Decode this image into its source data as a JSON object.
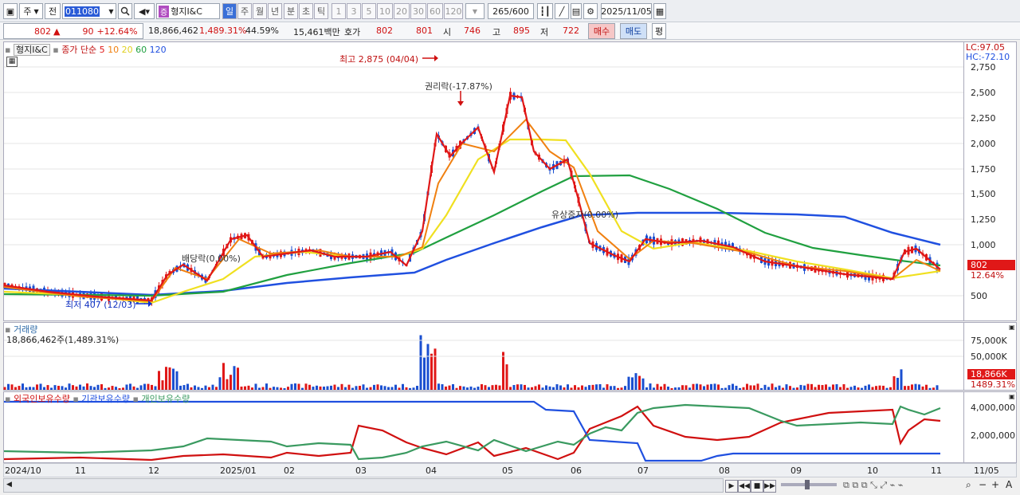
{
  "toolbar": {
    "period_select": "주",
    "prev_label": "전",
    "code_input": "011080",
    "badge": "증",
    "stock_name": "형지I&C",
    "periods": [
      "일",
      "주",
      "월",
      "년",
      "분",
      "초",
      "틱"
    ],
    "active_period": "일",
    "intervals": [
      "1",
      "3",
      "5",
      "10",
      "20",
      "30",
      "60",
      "120"
    ],
    "count_value": "265",
    "count_total": "/600",
    "date_value": "2025/11/05"
  },
  "quote": {
    "price": "802",
    "arrow": "▲",
    "change": "90",
    "change_pct": "+12.64%",
    "volume": "18,866,462",
    "volume_ratio": "1,489.31%",
    "turnover": "44.59%",
    "amount": "15,461백만",
    "hoga_label": "호가",
    "ask": "802",
    "bid": "801",
    "open_label": "시",
    "open": "746",
    "high_label": "고",
    "high": "895",
    "low_label": "저",
    "low": "722",
    "buy_btn": "매수",
    "sell_btn": "매도",
    "eval_btn": "평"
  },
  "price_panel": {
    "name": "형지I&C",
    "legend_prefix": "종가 단순",
    "ma_labels": [
      "5",
      "10",
      "20",
      "60",
      "120"
    ],
    "ma_colors": [
      "#e01818",
      "#f08010",
      "#f0e020",
      "#20a040",
      "#2050e0"
    ],
    "annotations": {
      "high": "최고 2,875 (04/04)",
      "rights": "권리락(-17.87%)",
      "dividend": "배당락(0.00%)",
      "paid_in": "유상증자(0.00%)",
      "low": "최저 407 (12/03)"
    },
    "lc": "LC:97.05",
    "hc": "HC:-72.10",
    "yticks": [
      "2,750",
      "2,500",
      "2,250",
      "2,000",
      "1,750",
      "1,500",
      "1,250",
      "1,000",
      "500"
    ],
    "current_tag": "802",
    "current_pct": "12.64%"
  },
  "volume_panel": {
    "title": "거래량",
    "subtitle": "18,866,462주(1,489.31%)",
    "yticks": [
      "75,000K",
      "50,000K"
    ],
    "current_tag": "18,866K",
    "current_pct": "1489.31%"
  },
  "holders_panel": {
    "legend": [
      "외국인보유수량",
      "기관보유수량",
      "개인보유수량"
    ],
    "yticks": [
      "4,000,000",
      "2,000,000"
    ]
  },
  "xaxis": {
    "labels": [
      "2024/10",
      "11",
      "12",
      "2025/01",
      "02",
      "03",
      "04",
      "05",
      "06",
      "07",
      "08",
      "09",
      "10",
      "11",
      "11/05"
    ]
  }
}
